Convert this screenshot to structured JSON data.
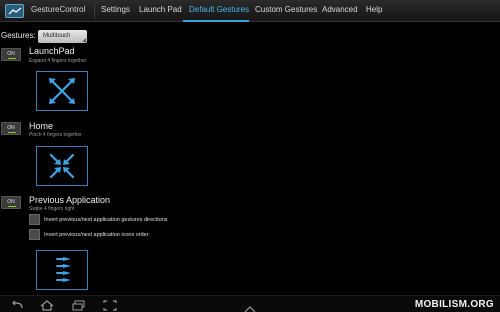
{
  "app": {
    "title": "GestureControl"
  },
  "tabs": [
    {
      "label": "Settings"
    },
    {
      "label": "Launch Pad"
    },
    {
      "label": "Default Gestures"
    },
    {
      "label": "Custom Gestures"
    },
    {
      "label": "Advanced"
    },
    {
      "label": "Help"
    }
  ],
  "active_tab": "Default Gestures",
  "gestures_selector": {
    "label": "Gestures:",
    "value": "Multitouch"
  },
  "gestures": [
    {
      "title": "LaunchPad",
      "subtitle": "Expand 4 fingers together",
      "toggle": "ON",
      "icon": "expand-fingers-icon"
    },
    {
      "title": "Home",
      "subtitle": "Pinch 4 fingers together",
      "toggle": "ON",
      "icon": "pinch-fingers-icon"
    },
    {
      "title": "Previous Application",
      "subtitle": "Swipe 4 fingers right",
      "toggle": "ON",
      "icon": "swipe-right-icon",
      "options": [
        {
          "label": "Invert previous/next application gestures directions",
          "checked": false
        },
        {
          "label": "Invert previous/next application icons order",
          "checked": false
        }
      ]
    }
  ],
  "colors": {
    "accent": "#2ea3d8",
    "toggle_led": "#8ccf2f",
    "gesture_tile_border": "#3d7fb6"
  },
  "watermark": "MOBILISM.ORG"
}
